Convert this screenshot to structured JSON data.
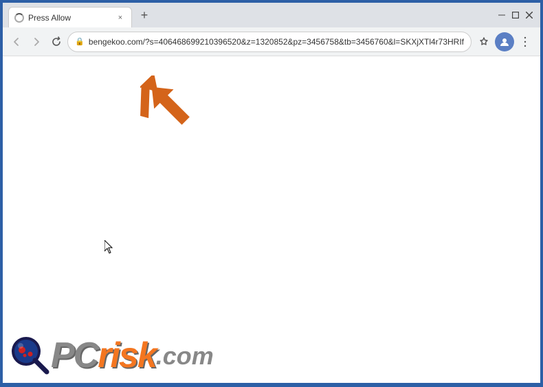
{
  "browser": {
    "title": "Press Allow",
    "url": "bengekoo.com/?s=406468699210396520&z=1320852&pz=3456758&tb=3456760&l=SKXjXTl4r73HRIf",
    "tab": {
      "title": "Press Allow",
      "close_label": "×"
    },
    "new_tab_label": "+",
    "window_controls": {
      "minimize": "—",
      "maximize": "□",
      "close": "✕"
    },
    "nav": {
      "back_label": "←",
      "forward_label": "→",
      "close_label": "✕",
      "lock_label": "🔒"
    },
    "nav_right": {
      "star_label": "☆",
      "menu_label": "⋮"
    }
  },
  "logo": {
    "pc_text": "PC",
    "risk_text": "risk",
    "dot_com": ".com"
  }
}
